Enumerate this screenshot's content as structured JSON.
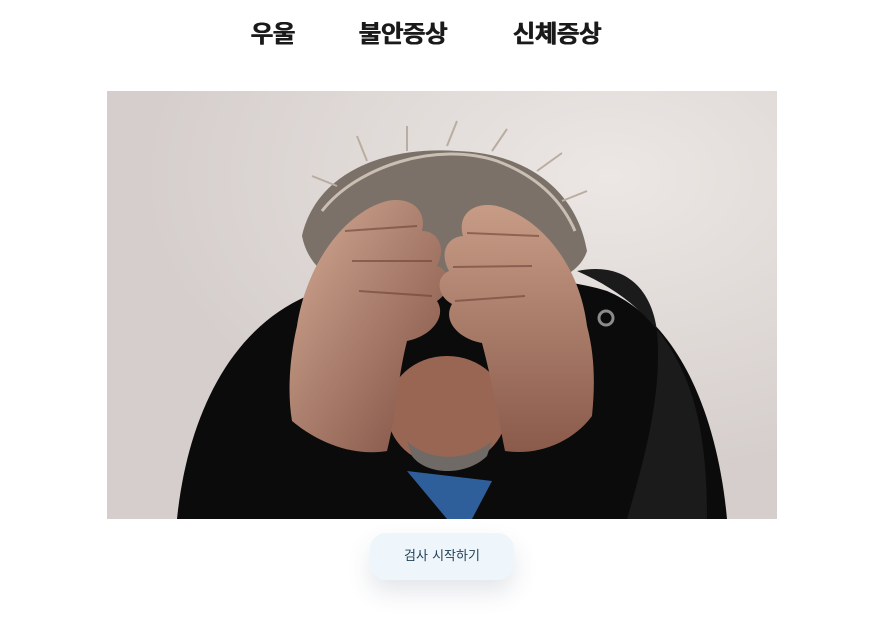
{
  "nav": {
    "tabs": [
      {
        "label": "우울"
      },
      {
        "label": "불안증상"
      },
      {
        "label": "신체증상"
      }
    ]
  },
  "hero": {
    "subject": "man holding head in hands"
  },
  "actions": {
    "start_label": "검사 시작하기"
  },
  "colors": {
    "tab_text": "#1a1a1a",
    "button_bg": "#eef6fc",
    "button_text": "#1f3f55",
    "photo_background": "#ddd6d4"
  }
}
